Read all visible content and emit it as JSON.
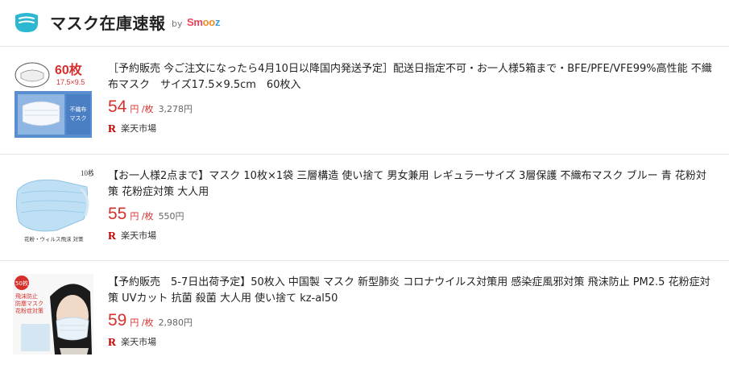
{
  "header": {
    "title": "マスク在庫速報",
    "by": "by",
    "brand": {
      "part1": "Sm",
      "part2": "oo",
      "part3": "z"
    }
  },
  "colors": {
    "price": "#d6302e",
    "rakuten": "#bf0000",
    "logo": "#2cb8d0",
    "divider": "#e6e6e6"
  },
  "items": [
    {
      "title": "［予約販売 今ご注文になったら4月10日以降国内発送予定］配送日指定不可・お一人様5箱まで・BFE/PFE/VFE99%高性能 不織布マスク　サイズ17.5×9.5cm　60枚入",
      "price": "54",
      "unit": "円 /枚",
      "total": "3,278円",
      "shop": "楽天市場",
      "thumb_text": {
        "count": "60枚",
        "size": "17.5×9.5",
        "box": "不織布\nマスク"
      }
    },
    {
      "title": "【お一人様2点まで】マスク 10枚×1袋 三層構造 使い捨て 男女兼用 レギュラーサイズ 3層保護 不織布マスク ブルー 青 花粉対策 花粉症対策 大人用",
      "price": "55",
      "unit": "円 /枚",
      "total": "550円",
      "shop": "楽天市場",
      "thumb_text": {
        "count": "10枚",
        "caption": "花粉・ウィルス飛沫 対策"
      }
    },
    {
      "title": "【予約販売　5-7日出荷予定】50枚入 中国製 マスク 新型肺炎 コロナウイルス対策用 感染症風邪対策 飛沫防止 PM2.5 花粉症対策 UVカット 抗菌 殺菌 大人用 使い捨て kz-al50",
      "price": "59",
      "unit": "円 /枚",
      "total": "2,980円",
      "shop": "楽天市場",
      "thumb_text": {
        "count": "50枚",
        "line1": "飛沫防止",
        "line2": "防塵マスク",
        "line3": "花粉症対策"
      }
    }
  ]
}
